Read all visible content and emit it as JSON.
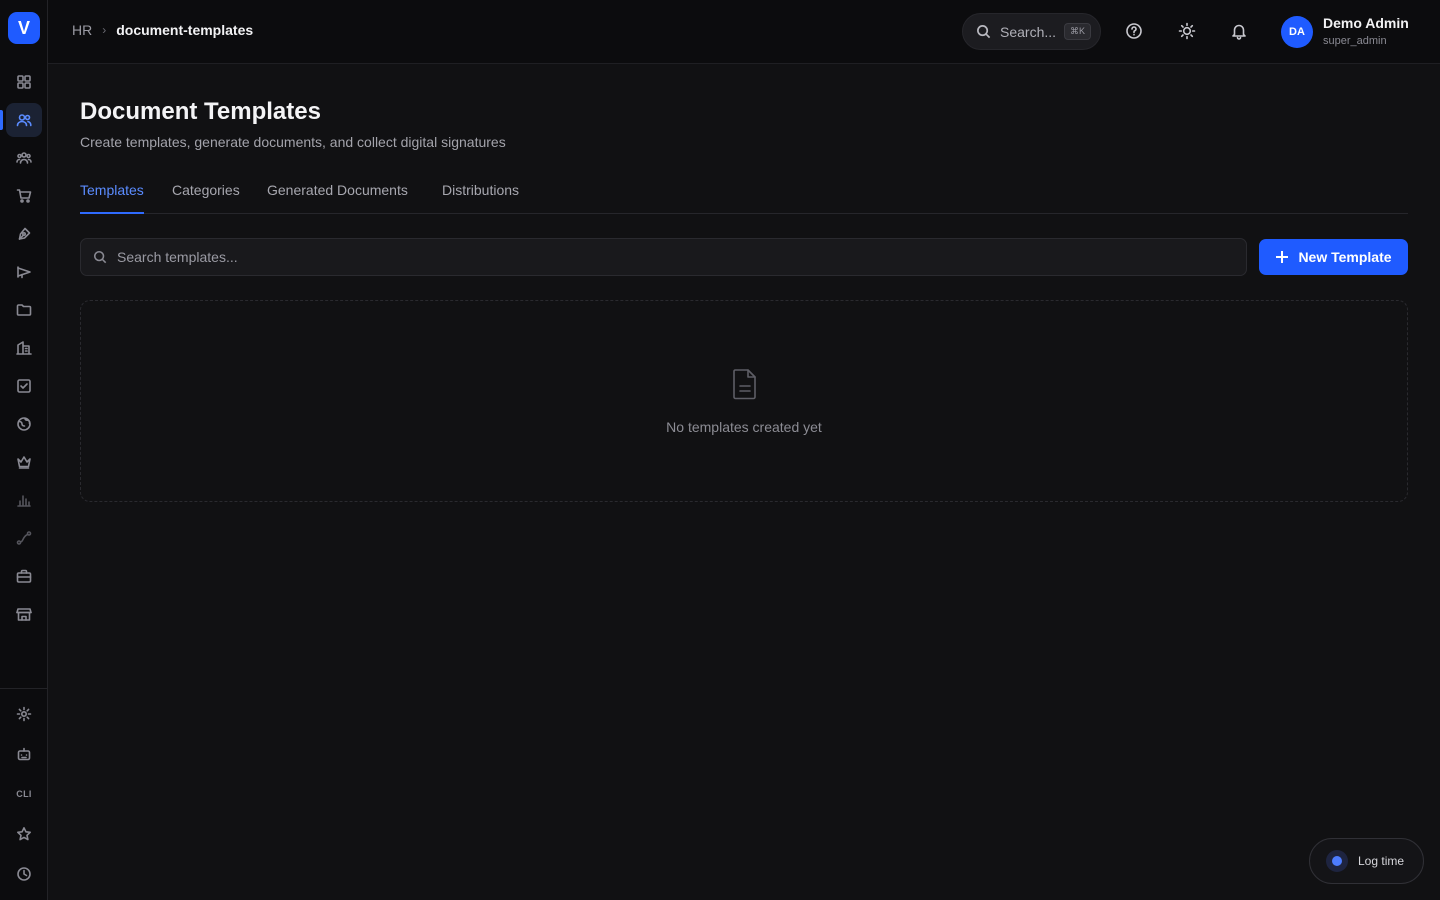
{
  "app": {
    "logo_letter": "V"
  },
  "breadcrumb": {
    "root": "HR",
    "separator": "›",
    "current": "document-templates"
  },
  "header": {
    "search_label": "Search...",
    "search_shortcut": "⌘K",
    "user": {
      "initials": "DA",
      "name": "Demo Admin",
      "role": "super_admin"
    }
  },
  "sidebar": {
    "items": [
      {
        "icon": "grid-icon"
      },
      {
        "icon": "users-icon",
        "active": true
      },
      {
        "icon": "team-icon"
      },
      {
        "icon": "cart-icon"
      },
      {
        "icon": "pen-tool-icon"
      },
      {
        "icon": "megaphone-icon"
      },
      {
        "icon": "folder-icon"
      },
      {
        "icon": "building-icon"
      },
      {
        "icon": "checkbox-icon"
      },
      {
        "icon": "globe-icon"
      },
      {
        "icon": "crown-icon"
      },
      {
        "icon": "bar-chart-icon"
      },
      {
        "icon": "route-icon"
      },
      {
        "icon": "briefcase-icon"
      },
      {
        "icon": "store-icon"
      }
    ],
    "bottom": [
      {
        "icon": "gear-icon"
      },
      {
        "icon": "robot-icon"
      },
      {
        "label": "CLI"
      },
      {
        "icon": "star-icon"
      },
      {
        "icon": "clock-icon"
      }
    ]
  },
  "page": {
    "title": "Document Templates",
    "subtitle": "Create templates, generate documents, and collect digital signatures"
  },
  "tabs": [
    {
      "label": "Templates",
      "active": true
    },
    {
      "label": "Categories"
    },
    {
      "label": "Generated Documents"
    },
    {
      "label": "Distributions"
    }
  ],
  "toolbar": {
    "search_placeholder": "Search templates...",
    "new_button": "New Template"
  },
  "empty_state": {
    "message": "No templates created yet"
  },
  "log_time": {
    "label": "Log time"
  },
  "colors": {
    "accent": "#1f5bff",
    "background": "#111113",
    "sidebar": "#0c0c0e"
  }
}
